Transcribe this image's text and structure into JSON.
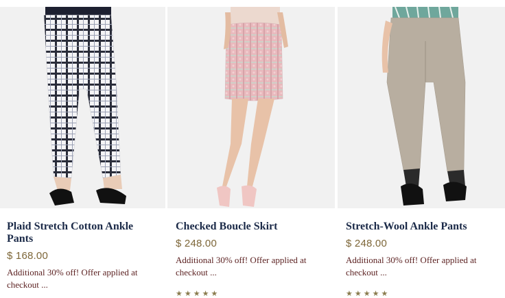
{
  "products": [
    {
      "name": "Plaid Stretch Cotton Ankle Pants",
      "price": "$ 168.00",
      "offer": "Additional 30% off! Offer applied at checkout ..."
    },
    {
      "name": "Checked Boucle Skirt",
      "price": "$ 248.00",
      "offer": "Additional 30% off! Offer applied at checkout ...",
      "stars": "★★★★★"
    },
    {
      "name": "Stretch-Wool Ankle Pants",
      "price": "$ 248.00",
      "offer": "Additional 30% off! Offer applied at checkout ...",
      "stars": "★★★★★"
    }
  ],
  "colors": {
    "name": "#1b2a48",
    "price": "#7d6638",
    "offer": "#5a1f1f"
  }
}
